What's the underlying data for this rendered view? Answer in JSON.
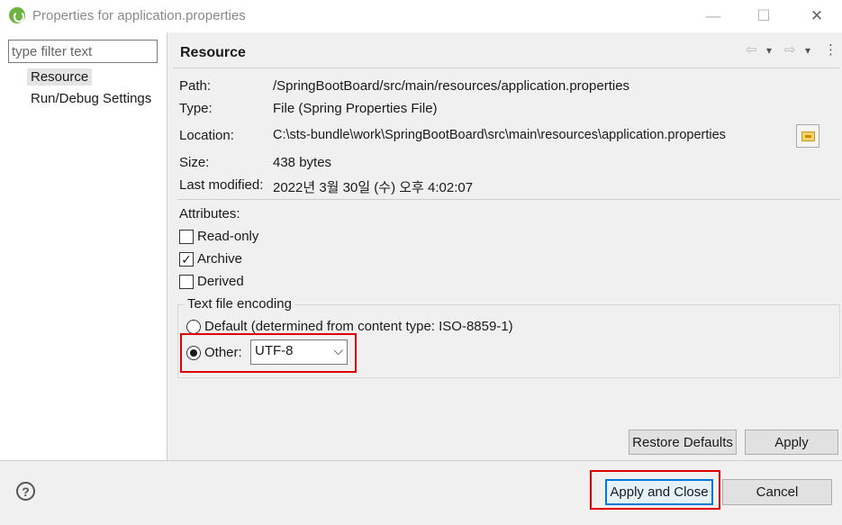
{
  "window": {
    "title": "Properties for application.properties",
    "icon": "spring-leaf-icon",
    "minimize_glyph": "—",
    "maximize_glyph": "☐",
    "close_glyph": "✕"
  },
  "sidebar": {
    "filter_placeholder": "type filter text",
    "items": [
      {
        "label": "Resource",
        "selected": true
      },
      {
        "label": "Run/Debug Settings",
        "selected": false
      }
    ]
  },
  "page": {
    "title": "Resource",
    "nav": {
      "back": "⇦",
      "back_menu": "▾",
      "forward": "⇨",
      "forward_menu": "▾",
      "menu": "⋮"
    },
    "path": {
      "label": "Path:",
      "value": "/SpringBootBoard/src/main/resources/application.properties"
    },
    "type": {
      "label": "Type:",
      "value": "File  (Spring Properties File)"
    },
    "location": {
      "label": "Location:",
      "value": "C:\\sts-bundle\\work\\SpringBootBoard\\src\\main\\resources\\application.properties"
    },
    "size": {
      "label": "Size:",
      "value": "438  bytes"
    },
    "last_modified": {
      "label": "Last modified:",
      "value": "2022년 3월 30일 (수) 오후 4:02:07"
    },
    "attributes": {
      "label": "Attributes:",
      "read_only": {
        "label": "Read-only",
        "checked": false,
        "mark": ""
      },
      "archive": {
        "label": "Archive",
        "checked": true,
        "mark": "✓"
      },
      "derived": {
        "label": "Derived",
        "checked": false,
        "mark": ""
      }
    },
    "encoding": {
      "group_label": "Text file encoding",
      "default_option": "Default (determined from content type: ISO-8859-1)",
      "other_option": "Other:",
      "selected": "other",
      "value": "UTF-8"
    },
    "restore_defaults": "Restore Defaults",
    "apply": "Apply"
  },
  "footer": {
    "help": "?",
    "apply_and_close": "Apply and Close",
    "cancel": "Cancel"
  },
  "colors": {
    "highlight": "#e00000",
    "focus": "#0078d7",
    "spring_green": "#6db33f"
  }
}
